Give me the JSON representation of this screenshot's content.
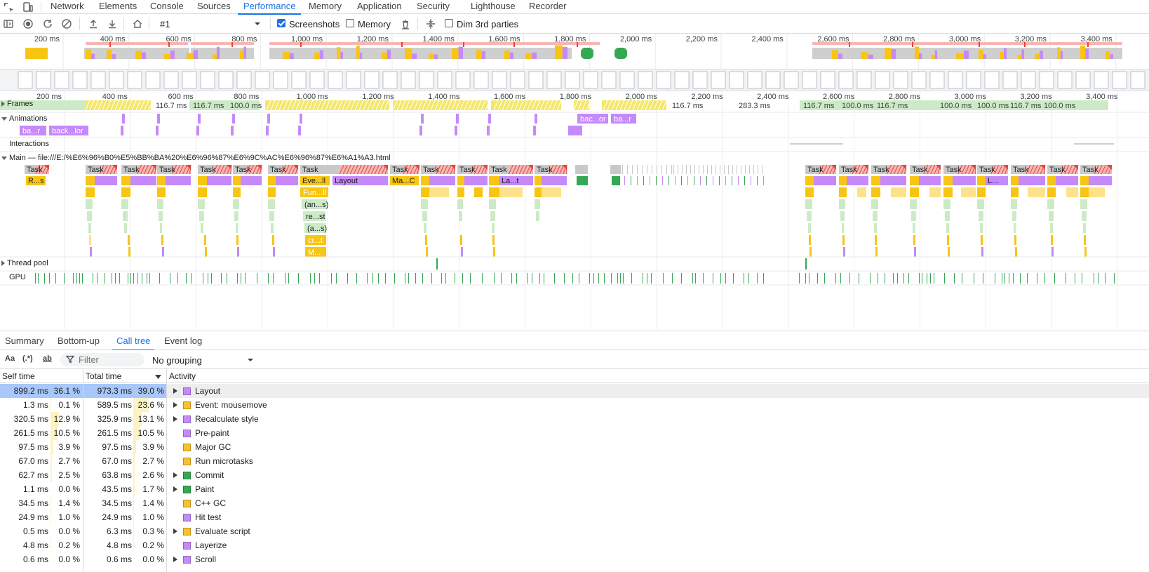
{
  "devtools_tabs": [
    {
      "label": "Network"
    },
    {
      "label": "Elements"
    },
    {
      "label": "Console"
    },
    {
      "label": "Sources"
    },
    {
      "label": "Performance",
      "active": true
    },
    {
      "label": "Memory"
    },
    {
      "label": "Application"
    },
    {
      "label": "Security"
    },
    {
      "label": "Lighthouse"
    },
    {
      "label": "Recorder"
    }
  ],
  "toolbar": {
    "recording_select": "#1",
    "screenshots_label": "Screenshots",
    "screenshots_checked": true,
    "memory_label": "Memory",
    "memory_checked": false,
    "dim_third_parties_label": "Dim 3rd parties",
    "dim_third_parties_checked": false
  },
  "overview": {
    "ruler_ticks": [
      "200 ms",
      "400 ms",
      "600 ms",
      "800 ms",
      "1,000 ms",
      "1,200 ms",
      "1,400 ms",
      "1,600 ms",
      "1,800 ms",
      "2,000 ms",
      "2,200 ms",
      "2,400 ms",
      "2,600 ms",
      "2,800 ms",
      "3,000 ms",
      "3,200 ms",
      "3,400 ms"
    ]
  },
  "timeline": {
    "ruler_ticks": [
      "200 ms",
      "400 ms",
      "600 ms",
      "800 ms",
      "1,000 ms",
      "1,200 ms",
      "1,400 ms",
      "1,600 ms",
      "1,800 ms",
      "2,000 ms",
      "2,200 ms",
      "2,400 ms",
      "2,600 ms",
      "2,800 ms",
      "3,000 ms",
      "3,200 ms",
      "3,400 ms"
    ],
    "tracks": {
      "frames": "Frames",
      "animations": "Animations",
      "interactions": "Interactions",
      "main": "Main — file:///E:/%E6%96%B0%E5%BB%BA%20%E6%96%87%E6%9C%AC%E6%96%87%E6%A1%A3.html",
      "thread_pool": "Thread pool",
      "gpu": "GPU"
    },
    "frame_labels": [
      {
        "text": "116.7 ms"
      },
      {
        "text": "116.7 ms"
      },
      {
        "text": "100.0 ms"
      },
      {
        "text": "116.7 ms"
      },
      {
        "text": "283.3 ms"
      },
      {
        "text": "116.7 ms"
      },
      {
        "text": "100.0 ms"
      },
      {
        "text": "116.7 ms"
      },
      {
        "text": "100.0 ms"
      },
      {
        "text": "100.0 ms"
      },
      {
        "text": "116.7 ms"
      },
      {
        "text": "100.0 ms"
      }
    ],
    "animation_labels": [
      "ba...r",
      "back...lor",
      "bac...or",
      "ba...r"
    ],
    "main_labels": {
      "task": "Task",
      "r_s": "R...s",
      "eve": "Eve...ll",
      "layout": "Layout",
      "mac": "Ma...C",
      "lat": "La...t",
      "l": "L...",
      "fun": "Fun...ll",
      "ans": "(an...s)",
      "rest": "re...st",
      "as": "(a...s)",
      "crt": "cr...t",
      "m": "M..."
    }
  },
  "bottom_tabs": [
    {
      "label": "Summary"
    },
    {
      "label": "Bottom-up"
    },
    {
      "label": "Call tree",
      "active": true
    },
    {
      "label": "Event log"
    }
  ],
  "filter": {
    "match_case": "Aa",
    "regex": "(.*)",
    "whole_word": "ab",
    "placeholder": "Filter",
    "grouping": "No grouping"
  },
  "calltree": {
    "headers": {
      "self_time": "Self time",
      "total_time": "Total time",
      "activity": "Activity"
    },
    "colors": {
      "rendering": "#c58af9",
      "scripting": "#fbc02d",
      "painting": "#34a853"
    },
    "rows": [
      {
        "self_ms": "899.2 ms",
        "self_pct": "36.1 %",
        "total_ms": "973.3 ms",
        "total_pct": "39.0 %",
        "activity": "Layout",
        "category": "rendering",
        "expandable": true,
        "self_frac": 0.361,
        "total_frac": 0.39
      },
      {
        "self_ms": "1.3 ms",
        "self_pct": "0.1 %",
        "total_ms": "589.5 ms",
        "total_pct": "23.6 %",
        "activity": "Event: mousemove",
        "category": "scripting",
        "expandable": true,
        "self_frac": 0.001,
        "total_frac": 0.236
      },
      {
        "self_ms": "320.5 ms",
        "self_pct": "12.9 %",
        "total_ms": "325.9 ms",
        "total_pct": "13.1 %",
        "activity": "Recalculate style",
        "category": "rendering",
        "expandable": true,
        "self_frac": 0.129,
        "total_frac": 0.131
      },
      {
        "self_ms": "261.5 ms",
        "self_pct": "10.5 %",
        "total_ms": "261.5 ms",
        "total_pct": "10.5 %",
        "activity": "Pre-paint",
        "category": "rendering",
        "expandable": false,
        "self_frac": 0.105,
        "total_frac": 0.105
      },
      {
        "self_ms": "97.5 ms",
        "self_pct": "3.9 %",
        "total_ms": "97.5 ms",
        "total_pct": "3.9 %",
        "activity": "Major GC",
        "category": "scripting",
        "expandable": false,
        "self_frac": 0.039,
        "total_frac": 0.039
      },
      {
        "self_ms": "67.0 ms",
        "self_pct": "2.7 %",
        "total_ms": "67.0 ms",
        "total_pct": "2.7 %",
        "activity": "Run microtasks",
        "category": "scripting",
        "expandable": false,
        "self_frac": 0.027,
        "total_frac": 0.027
      },
      {
        "self_ms": "62.7 ms",
        "self_pct": "2.5 %",
        "total_ms": "63.8 ms",
        "total_pct": "2.6 %",
        "activity": "Commit",
        "category": "painting",
        "expandable": true,
        "self_frac": 0.025,
        "total_frac": 0.026
      },
      {
        "self_ms": "1.1 ms",
        "self_pct": "0.0 %",
        "total_ms": "43.5 ms",
        "total_pct": "1.7 %",
        "activity": "Paint",
        "category": "painting",
        "expandable": true,
        "self_frac": 0.0,
        "total_frac": 0.017
      },
      {
        "self_ms": "34.5 ms",
        "self_pct": "1.4 %",
        "total_ms": "34.5 ms",
        "total_pct": "1.4 %",
        "activity": "C++ GC",
        "category": "scripting",
        "expandable": false,
        "self_frac": 0.014,
        "total_frac": 0.014
      },
      {
        "self_ms": "24.9 ms",
        "self_pct": "1.0 %",
        "total_ms": "24.9 ms",
        "total_pct": "1.0 %",
        "activity": "Hit test",
        "category": "rendering",
        "expandable": false,
        "self_frac": 0.01,
        "total_frac": 0.01
      },
      {
        "self_ms": "0.5 ms",
        "self_pct": "0.0 %",
        "total_ms": "6.3 ms",
        "total_pct": "0.3 %",
        "activity": "Evaluate script",
        "category": "scripting",
        "expandable": true,
        "self_frac": 0.0,
        "total_frac": 0.003
      },
      {
        "self_ms": "4.8 ms",
        "self_pct": "0.2 %",
        "total_ms": "4.8 ms",
        "total_pct": "0.2 %",
        "activity": "Layerize",
        "category": "rendering",
        "expandable": false,
        "self_frac": 0.002,
        "total_frac": 0.002
      },
      {
        "self_ms": "0.6 ms",
        "self_pct": "0.0 %",
        "total_ms": "0.6 ms",
        "total_pct": "0.0 %",
        "activity": "Scroll",
        "category": "rendering",
        "expandable": true,
        "self_frac": 0.0,
        "total_frac": 0.0
      }
    ]
  }
}
